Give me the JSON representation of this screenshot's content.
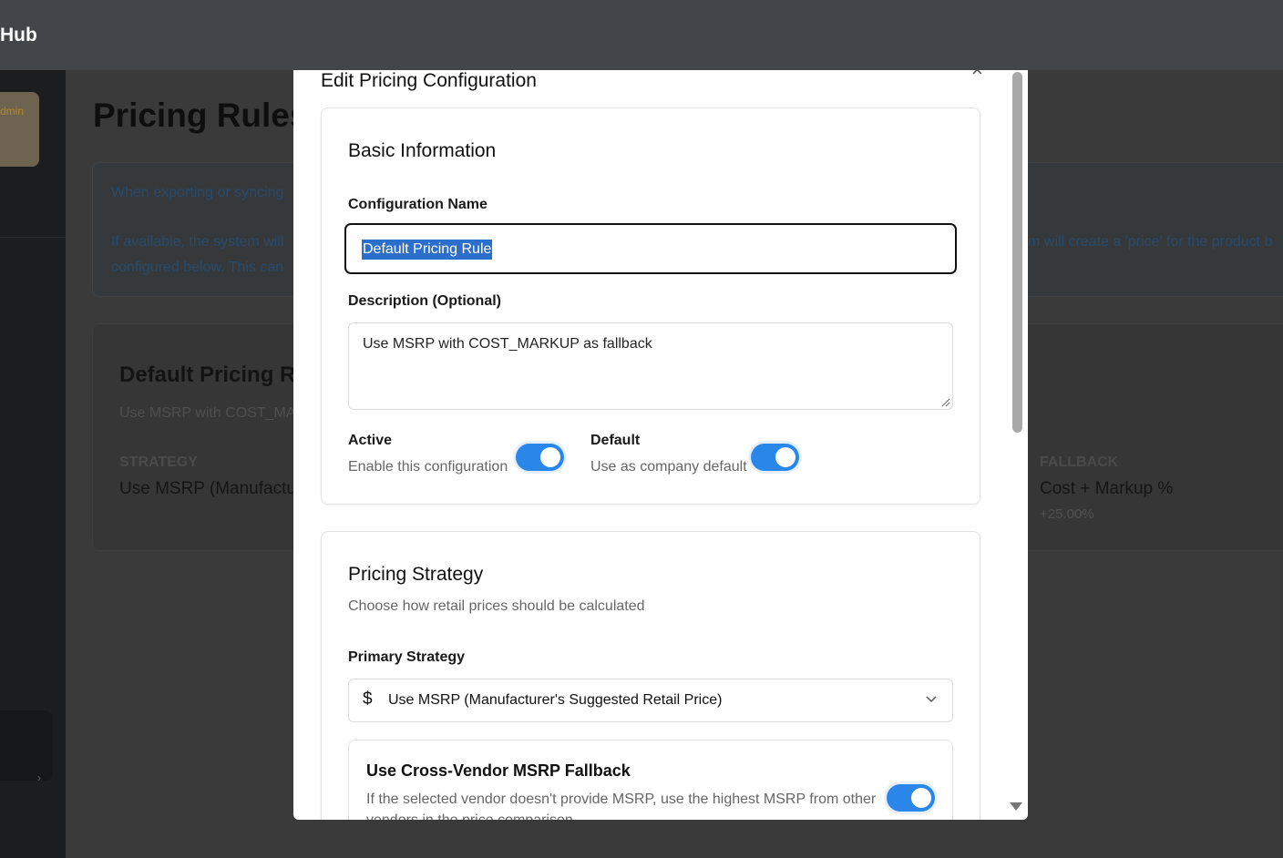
{
  "app": {
    "brand": "Hub"
  },
  "sidebar": {
    "admin_chip": "dmin",
    "chevron": "›"
  },
  "page": {
    "title": "Pricing Rules",
    "info_lines": [
      "When exporting or syncing",
      "If available, the system will",
      "configured below. This can",
      "m will create a 'price' for the product b"
    ],
    "rule_card": {
      "title": "Default Pricing Rul",
      "description": "Use MSRP with COST_MA",
      "strategy_label": "STRATEGY",
      "strategy_value": "Use MSRP (Manufactu",
      "fallback_label": "FALLBACK",
      "fallback_value": "Cost + Markup %",
      "fallback_sub": "+25.00%"
    }
  },
  "modal": {
    "title": "Edit Pricing Configuration",
    "close": "×",
    "basic": {
      "title": "Basic Information",
      "name_label": "Configuration Name",
      "name_value": "Default Pricing Rule",
      "description_label": "Description (Optional)",
      "description_value": "Use MSRP with COST_MARKUP as fallback",
      "active_label": "Active",
      "active_help": "Enable this configuration",
      "active_on": true,
      "default_label": "Default",
      "default_help": "Use as company default",
      "default_on": true
    },
    "strategy": {
      "title": "Pricing Strategy",
      "subtitle": "Choose how retail prices should be calculated",
      "primary_label": "Primary Strategy",
      "primary_icon": "$",
      "primary_value": "Use MSRP (Manufacturer's Suggested Retail Price)",
      "cross_vendor_title": "Use Cross-Vendor MSRP Fallback",
      "cross_vendor_desc": "If the selected vendor doesn't provide MSRP, use the highest MSRP from other vendors in the price comparison",
      "cross_vendor_on": true
    }
  },
  "colors": {
    "accent": "#2a86e8",
    "selection": "#2c6ecb"
  }
}
